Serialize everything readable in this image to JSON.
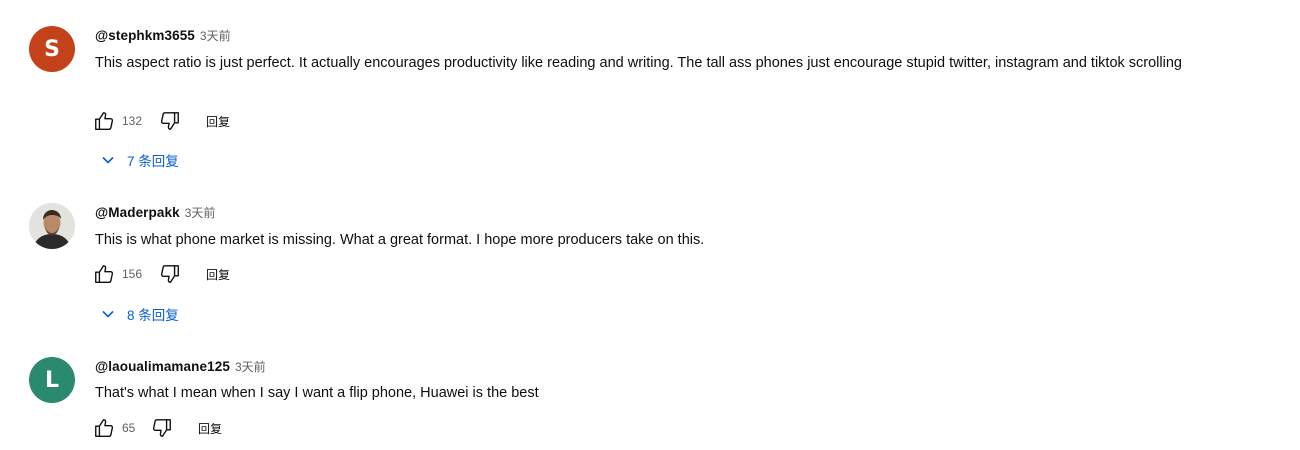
{
  "comments": [
    {
      "author": "@stephkm3655",
      "time": "3天前",
      "avatar_letter": "S",
      "avatar_color": "#c4421a",
      "text": "This aspect ratio is just perfect. It actually encourages productivity like reading and writing. The tall ass phones just encourage stupid twitter, instagram and tiktok scrolling",
      "likes": "132",
      "reply_label": "回复",
      "replies_label": "7 条回复"
    },
    {
      "author": "@Maderpakk",
      "time": "3天前",
      "avatar_letter": "",
      "avatar_color": "#8a8a8a",
      "text": "This is what phone market is missing. What a great format. I hope more producers take on this.",
      "likes": "156",
      "reply_label": "回复",
      "replies_label": "8 条回复"
    },
    {
      "author": "@laoualimamane125",
      "time": "3天前",
      "avatar_letter": "L",
      "avatar_color": "#2a8a6f",
      "text": "That's what I mean when I say I want a flip phone, Huawei is the best",
      "likes": "65",
      "reply_label": "回复"
    }
  ]
}
